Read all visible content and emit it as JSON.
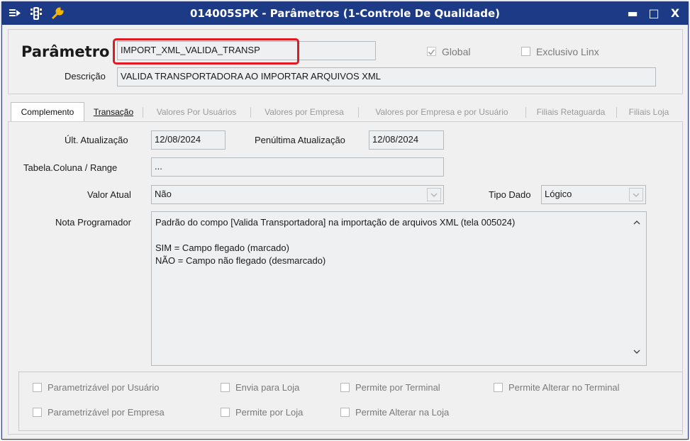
{
  "window": {
    "title": "014005SPK - Parâmetros (1-Controle De Qualidade)",
    "controls": {
      "minimize": "▬",
      "maximize": "□",
      "close": "X"
    }
  },
  "header": {
    "parametro_label": "Parâmetro",
    "parametro_value": "IMPORT_XML_VALIDA_TRANSP",
    "global_label": "Global",
    "global_checked": true,
    "exclusivo_label": "Exclusivo Linx",
    "exclusivo_checked": false,
    "descricao_label": "Descrição",
    "descricao_value": "VALIDA TRANSPORTADORA AO IMPORTAR ARQUIVOS XML"
  },
  "tabs": [
    {
      "label": "Complemento",
      "state": "active"
    },
    {
      "label": "Transação",
      "state": "enabled"
    },
    {
      "label": "Valores Por Usuários",
      "state": "disabled"
    },
    {
      "label": "Valores por Empresa",
      "state": "disabled"
    },
    {
      "label": "Valores por Empresa e por Usuário",
      "state": "disabled"
    },
    {
      "label": "Filiais Retaguarda",
      "state": "disabled"
    },
    {
      "label": "Filiais Loja",
      "state": "disabled"
    }
  ],
  "complemento": {
    "ult_atualizacao_label": "Últ. Atualização",
    "ult_atualizacao_value": "12/08/2024",
    "penultima_label": "Penúltima Atualização",
    "penultima_value": "12/08/2024",
    "tabela_label": "Tabela.Coluna / Range",
    "tabela_value": "...",
    "valor_atual_label": "Valor Atual",
    "valor_atual_value": "Não",
    "tipo_dado_label": "Tipo Dado",
    "tipo_dado_value": "Lógico",
    "nota_label": "Nota Programador",
    "nota_lines": [
      "Padrão do compo [Valida Transportadora] na importação de arquivos XML (tela 005024)",
      "",
      "SIM = Campo flegado (marcado)",
      "NÃO = Campo não flegado (desmarcado)"
    ]
  },
  "options": [
    {
      "label": "Parametrizável por Usuário",
      "checked": false
    },
    {
      "label": "Envia para Loja",
      "checked": false
    },
    {
      "label": "Permite por Terminal",
      "checked": false
    },
    {
      "label": "Permite Alterar no Terminal",
      "checked": false
    },
    {
      "label": "Parametrizável por Empresa",
      "checked": false
    },
    {
      "label": "Permite por Loja",
      "checked": false
    },
    {
      "label": "Permite Alterar na Loja",
      "checked": false
    }
  ],
  "colors": {
    "titlebar": "#1d3a86",
    "highlight": "#e01a22",
    "field_bg": "#eef0f1"
  },
  "icons": [
    "menu-icon",
    "traffic-light-icon",
    "wrench-icon",
    "check-icon",
    "chevron-down-icon",
    "chevron-up-icon"
  ]
}
